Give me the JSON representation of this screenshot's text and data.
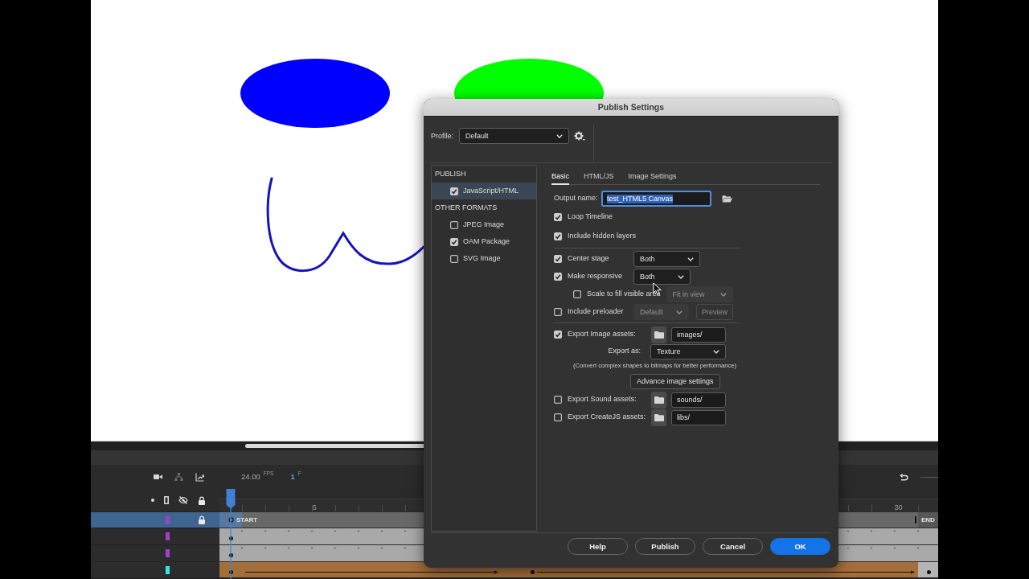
{
  "stage": {
    "shapes": [
      {
        "kind": "ellipse",
        "color": "#0000ff"
      },
      {
        "kind": "ellipse",
        "color": "#00ff00"
      },
      {
        "kind": "stroke",
        "color": "#1414c0"
      }
    ]
  },
  "dialog": {
    "title": "Publish Settings",
    "profile": {
      "label": "Profile:",
      "value": "Default"
    },
    "format_sections": [
      {
        "heading": "PUBLISH",
        "items": [
          {
            "label": "JavaScript/HTML",
            "checked": true,
            "selected": true
          }
        ]
      },
      {
        "heading": "OTHER FORMATS",
        "items": [
          {
            "label": "JPEG Image",
            "checked": false,
            "selected": false
          },
          {
            "label": "OAM Package",
            "checked": true,
            "selected": false
          },
          {
            "label": "SVG Image",
            "checked": false,
            "selected": false
          }
        ]
      }
    ],
    "tabs": [
      {
        "label": "Basic",
        "selected": true
      },
      {
        "label": "HTML/JS",
        "selected": false
      },
      {
        "label": "Image Settings",
        "selected": false
      }
    ],
    "output_name": {
      "label": "Output name:",
      "value": "test_HTML5 Canvas",
      "focused": true,
      "text_selected": true
    },
    "option_groups": [
      [
        {
          "kind": "checkbox",
          "label": "Loop Timeline",
          "checked": true
        },
        {
          "kind": "checkbox",
          "label": "Include hidden layers",
          "checked": true
        }
      ],
      [
        {
          "kind": "checkbox",
          "label": "Center stage",
          "checked": true,
          "select": {
            "value": "Both",
            "disabled": false
          }
        },
        {
          "kind": "checkbox",
          "label": "Make responsive",
          "checked": true,
          "select": {
            "value": "Both",
            "disabled": false
          },
          "children": [
            {
              "kind": "checkbox",
              "label": "Scale to fill visible area",
              "checked": false,
              "select": {
                "value": "Fit in view",
                "disabled": true
              }
            }
          ]
        },
        {
          "kind": "checkbox",
          "label": "Include preloader",
          "checked": false,
          "select": {
            "value": "Default",
            "disabled": true
          },
          "button": {
            "label": "Preview",
            "disabled": true
          }
        }
      ],
      [
        {
          "kind": "path",
          "label": "Export Image assets:",
          "checked": true,
          "value": "images/"
        },
        {
          "kind": "select",
          "label": "Export as:",
          "select": {
            "value": "Texture",
            "disabled": false
          }
        },
        {
          "kind": "note",
          "text": "(Convert complex shapes to bitmaps for better performance)"
        },
        {
          "kind": "button",
          "label": "Advance image settings"
        },
        {
          "kind": "path",
          "label": "Export Sound assets:",
          "checked": false,
          "value": "sounds/"
        },
        {
          "kind": "path",
          "label": "Export CreateJS assets:",
          "checked": false,
          "value": "libs/"
        }
      ]
    ],
    "buttons": [
      {
        "label": "Help",
        "primary": false
      },
      {
        "label": "Publish",
        "primary": false
      },
      {
        "label": "Cancel",
        "primary": false
      },
      {
        "label": "OK",
        "primary": true
      }
    ]
  },
  "timeline": {
    "fps": "24.00",
    "fps_unit": "FPS",
    "current_frame": "1",
    "frame_unit": "F",
    "ruler_labels": [
      "5",
      "30"
    ],
    "layers": [
      {
        "kind": "labels",
        "selected": true,
        "locked": true,
        "color": "#a23fd0",
        "frame_labels": [
          "START",
          "END"
        ]
      },
      {
        "kind": "keyframes",
        "selected": false,
        "locked": false,
        "color": "#a23fd0"
      },
      {
        "kind": "keyframes",
        "selected": false,
        "locked": false,
        "color": "#a23fd0"
      },
      {
        "kind": "tween",
        "selected": false,
        "locked": false,
        "color": "#33e6e6"
      }
    ]
  }
}
